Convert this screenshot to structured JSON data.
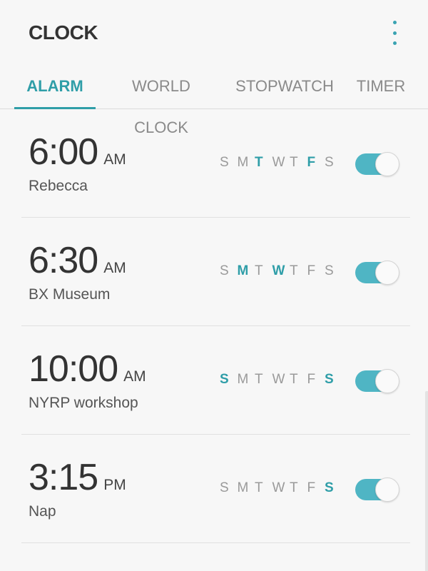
{
  "header": {
    "title": "CLOCK",
    "more_icon": "more-vertical-icon"
  },
  "tabs": [
    {
      "label": "ALARM",
      "active": true
    },
    {
      "label": "WORLD CLOCK",
      "active": false
    },
    {
      "label": "STOPWATCH",
      "active": false
    },
    {
      "label": "TIMER",
      "active": false
    }
  ],
  "colors": {
    "accent": "#2f9ea8",
    "toggle_on": "#4fb5c4",
    "text_primary": "#333333",
    "text_inactive": "#9a9a9a"
  },
  "alarms": [
    {
      "time": "6:00",
      "ampm": "AM",
      "label": "Rebecca",
      "days": [
        {
          "letter": "S",
          "on": false
        },
        {
          "letter": "M",
          "on": false
        },
        {
          "letter": "T",
          "on": true
        },
        {
          "letter": "W",
          "on": false
        },
        {
          "letter": "T",
          "on": false
        },
        {
          "letter": "F",
          "on": true
        },
        {
          "letter": "S",
          "on": false
        }
      ],
      "enabled": true
    },
    {
      "time": "6:30",
      "ampm": "AM",
      "label": "BX Museum",
      "days": [
        {
          "letter": "S",
          "on": false
        },
        {
          "letter": "M",
          "on": true
        },
        {
          "letter": "T",
          "on": false
        },
        {
          "letter": "W",
          "on": true
        },
        {
          "letter": "T",
          "on": false
        },
        {
          "letter": "F",
          "on": false
        },
        {
          "letter": "S",
          "on": false
        }
      ],
      "enabled": true
    },
    {
      "time": "10:00",
      "ampm": "AM",
      "label": "NYRP workshop",
      "days": [
        {
          "letter": "S",
          "on": true
        },
        {
          "letter": "M",
          "on": false
        },
        {
          "letter": "T",
          "on": false
        },
        {
          "letter": "W",
          "on": false
        },
        {
          "letter": "T",
          "on": false
        },
        {
          "letter": "F",
          "on": false
        },
        {
          "letter": "S",
          "on": true
        }
      ],
      "enabled": true
    },
    {
      "time": "3:15",
      "ampm": "PM",
      "label": "Nap",
      "days": [
        {
          "letter": "S",
          "on": false
        },
        {
          "letter": "M",
          "on": false
        },
        {
          "letter": "T",
          "on": false
        },
        {
          "letter": "W",
          "on": false
        },
        {
          "letter": "T",
          "on": false
        },
        {
          "letter": "F",
          "on": false
        },
        {
          "letter": "S",
          "on": true
        }
      ],
      "enabled": true
    }
  ]
}
